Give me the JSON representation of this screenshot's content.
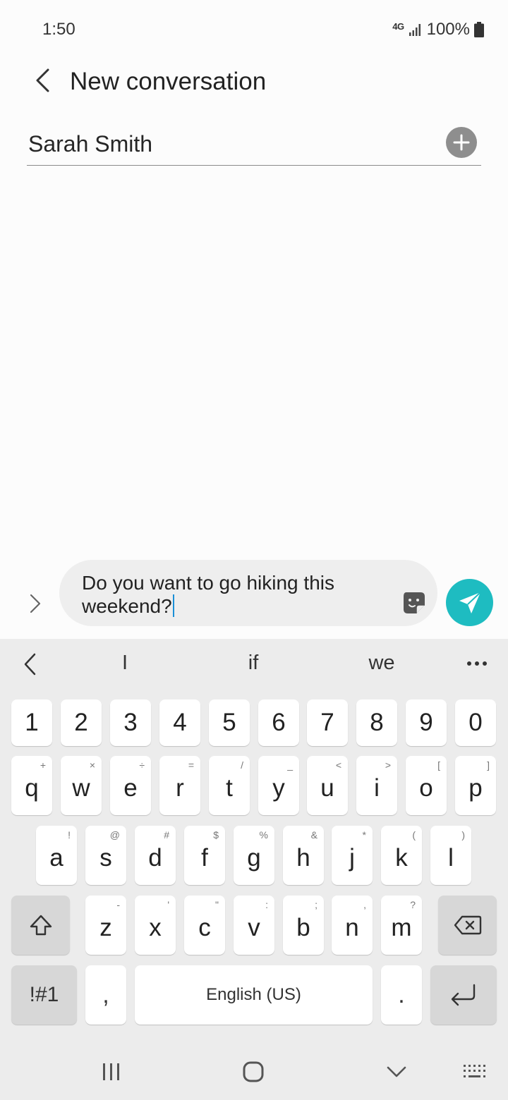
{
  "status_bar": {
    "time": "1:50",
    "network": "4G",
    "battery": "100%"
  },
  "header": {
    "title": "New conversation",
    "back_icon": "chevron-left-icon"
  },
  "recipient": {
    "name": "Sarah Smith",
    "add_icon": "plus-circle-icon"
  },
  "composer": {
    "message": "Do you want to go hiking this\nweekend?",
    "expand_icon": "chevron-right-icon",
    "sticker_icon": "sticker-icon",
    "send_icon": "send-icon",
    "send_color": "#1ebcc1"
  },
  "keyboard": {
    "suggestions": [
      "I",
      "if",
      "we"
    ],
    "more_icon": "more-horizontal-icon",
    "number_row": [
      "1",
      "2",
      "3",
      "4",
      "5",
      "6",
      "7",
      "8",
      "9",
      "0"
    ],
    "row1": [
      {
        "key": "q",
        "hint": "+"
      },
      {
        "key": "w",
        "hint": "×"
      },
      {
        "key": "e",
        "hint": "÷"
      },
      {
        "key": "r",
        "hint": "="
      },
      {
        "key": "t",
        "hint": "/"
      },
      {
        "key": "y",
        "hint": "_"
      },
      {
        "key": "u",
        "hint": "<"
      },
      {
        "key": "i",
        "hint": ">"
      },
      {
        "key": "o",
        "hint": "["
      },
      {
        "key": "p",
        "hint": "]"
      }
    ],
    "row2": [
      {
        "key": "a",
        "hint": "!"
      },
      {
        "key": "s",
        "hint": "@"
      },
      {
        "key": "d",
        "hint": "#"
      },
      {
        "key": "f",
        "hint": "$"
      },
      {
        "key": "g",
        "hint": "%"
      },
      {
        "key": "h",
        "hint": "&"
      },
      {
        "key": "j",
        "hint": "*"
      },
      {
        "key": "k",
        "hint": "("
      },
      {
        "key": "l",
        "hint": ")"
      }
    ],
    "row3": [
      {
        "key": "z",
        "hint": "-"
      },
      {
        "key": "x",
        "hint": "'"
      },
      {
        "key": "c",
        "hint": "\""
      },
      {
        "key": "v",
        "hint": ":"
      },
      {
        "key": "b",
        "hint": ";"
      },
      {
        "key": "n",
        "hint": ","
      },
      {
        "key": "m",
        "hint": "?"
      }
    ],
    "symbols_label": "!#1",
    "comma_label": ",",
    "space_label": "English (US)",
    "period_label": ".",
    "shift_icon": "shift-icon",
    "backspace_icon": "backspace-icon",
    "enter_icon": "enter-icon"
  },
  "nav_bar": {
    "recents_icon": "recents-icon",
    "home_icon": "home-icon",
    "hide_keyboard_icon": "chevron-down-icon",
    "keyboard_switch_icon": "keyboard-icon"
  }
}
